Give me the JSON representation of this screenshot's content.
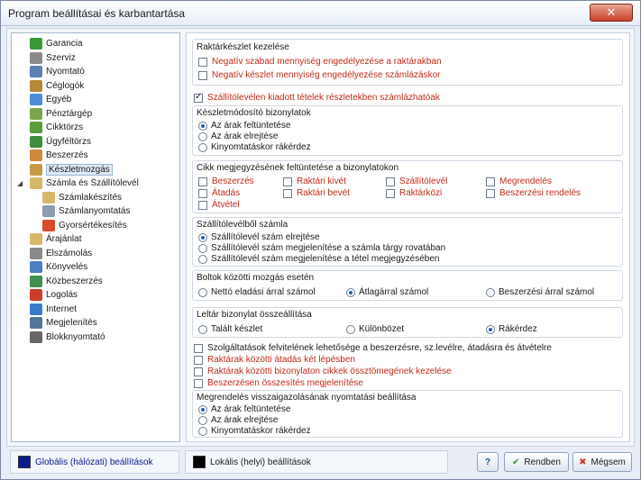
{
  "window": {
    "title": "Program beállításai és karbantartása",
    "close_glyph": "✕"
  },
  "tree": [
    {
      "label": "Garancia",
      "icon": "shield-icon",
      "color": "#3a9a3a",
      "level": 1,
      "selected": false
    },
    {
      "label": "Szerviz",
      "icon": "wrench-icon",
      "color": "#8a8a8a",
      "level": 1,
      "selected": false
    },
    {
      "label": "Nyomtató",
      "icon": "printer-icon",
      "color": "#5b7fb1",
      "level": 1,
      "selected": false
    },
    {
      "label": "Céglogók",
      "icon": "logo-icon",
      "color": "#b5883a",
      "level": 1,
      "selected": false
    },
    {
      "label": "Egyéb",
      "icon": "home-icon",
      "color": "#4d8ed6",
      "level": 1,
      "selected": false
    },
    {
      "label": "Pénztárgép",
      "icon": "cash-register-icon",
      "color": "#7aa64e",
      "level": 1,
      "selected": false
    },
    {
      "label": "Cikktörzs",
      "icon": "product-icon",
      "color": "#5a9e3c",
      "level": 1,
      "selected": false
    },
    {
      "label": "Ügyféltörzs",
      "icon": "customer-icon",
      "color": "#3d8d3d",
      "level": 1,
      "selected": false
    },
    {
      "label": "Beszerzés",
      "icon": "purchase-icon",
      "color": "#cf8a3c",
      "level": 1,
      "selected": false
    },
    {
      "label": "Készletmozgás",
      "icon": "stock-movement-icon",
      "color": "#c69a45",
      "level": 1,
      "selected": true
    },
    {
      "label": "Számla és Szállítólevél",
      "icon": "invoice-icon",
      "color": "#d7b86a",
      "level": 1,
      "selected": false,
      "expanded": true
    },
    {
      "label": "Számlakészítés",
      "icon": "invoice-create-icon",
      "color": "#d7b86a",
      "level": 2,
      "selected": false
    },
    {
      "label": "Számlanyomtatás",
      "icon": "invoice-print-icon",
      "color": "#8d9bb0",
      "level": 2,
      "selected": false
    },
    {
      "label": "Gyorsértékesítés",
      "icon": "quick-sale-icon",
      "color": "#d74c2c",
      "level": 2,
      "selected": false
    },
    {
      "label": "Árajánlat",
      "icon": "quote-icon",
      "color": "#d7b86a",
      "level": 1,
      "selected": false
    },
    {
      "label": "Elszámolás",
      "icon": "settlement-icon",
      "color": "#8a8a8a",
      "level": 1,
      "selected": false
    },
    {
      "label": "Könyvelés",
      "icon": "accounting-icon",
      "color": "#4f7ec2",
      "level": 1,
      "selected": false
    },
    {
      "label": "Közbeszerzés",
      "icon": "public-procurement-icon",
      "color": "#3f8f4f",
      "level": 1,
      "selected": false
    },
    {
      "label": "Logolás",
      "icon": "log-icon",
      "color": "#cc3d2d",
      "level": 1,
      "selected": false
    },
    {
      "label": "Internet",
      "icon": "globe-icon",
      "color": "#3a7bc8",
      "level": 1,
      "selected": false
    },
    {
      "label": "Megjelenítés",
      "icon": "display-icon",
      "color": "#557499",
      "level": 1,
      "selected": false
    },
    {
      "label": "Blokknyomtató",
      "icon": "receipt-printer-icon",
      "color": "#666666",
      "level": 1,
      "selected": false
    }
  ],
  "inventory": {
    "title": "Raktárkészlet kezelése",
    "options": [
      {
        "label": "Negatív szabad mennyiség engedélyezése a raktárakban",
        "checked": false
      },
      {
        "label": "Negatív készlet mennyiség engedélyezése számlázáskor",
        "checked": false
      }
    ]
  },
  "partial_delivery": {
    "label": "Szállítólevélen kiadott tételek részletekben számlázhatóak",
    "checked": true
  },
  "stock_docs": {
    "title": "Készletmódosító bizonylatok",
    "options": [
      {
        "label": "Az árak feltüntetése",
        "checked": true
      },
      {
        "label": "Az árak elrejtése",
        "checked": false
      },
      {
        "label": "Kinyomtatáskor rákérdez",
        "checked": false
      }
    ]
  },
  "notes": {
    "title": "Cikk megjegyzésének feltüntetése a bizonylatokon",
    "items": [
      {
        "label": "Beszerzés",
        "checked": false
      },
      {
        "label": "Raktári kivét",
        "checked": false
      },
      {
        "label": "Szállítólevél",
        "checked": false
      },
      {
        "label": "Megrendelés",
        "checked": false
      },
      {
        "label": "Átadás",
        "checked": false
      },
      {
        "label": "Raktári bevét",
        "checked": false
      },
      {
        "label": "Raktárközi",
        "checked": false
      },
      {
        "label": "Beszerzési rendelés",
        "checked": false
      },
      {
        "label": "Átvétel",
        "checked": false
      }
    ]
  },
  "delivery_invoice": {
    "title": "Szállítólevélből számla",
    "options": [
      {
        "label": "Szállítólevél szám elrejtése",
        "checked": true
      },
      {
        "label": "Szállítólevél szám megjelenítése a számla tárgy rovatában",
        "checked": false
      },
      {
        "label": "Szállítólevél szám megjelenítése a tétel megjegyzésében",
        "checked": false
      }
    ]
  },
  "shop_move": {
    "title": "Boltok közötti mozgás esetén",
    "options": [
      {
        "label": "Nettó eladási árral számol",
        "checked": false
      },
      {
        "label": "Átlagárral számol",
        "checked": true
      },
      {
        "label": "Beszerzési árral számol",
        "checked": false
      }
    ]
  },
  "inventory_doc": {
    "title": "Leltár bizonylat összeállítása",
    "options": [
      {
        "label": "Talált készlet",
        "checked": false
      },
      {
        "label": "Különbözet",
        "checked": false
      },
      {
        "label": "Rákérdez",
        "checked": true
      }
    ]
  },
  "misc": [
    {
      "label": "Szolgáltatások felvitelének lehetősége a beszerzésre, sz.levélre, átadásra és átvételre",
      "checked": false
    },
    {
      "label": "Raktárak közötti átadás két lépésben",
      "checked": false
    },
    {
      "label": "Raktárak közötti bizonylaton cikkek össztömegének kezelése",
      "checked": false
    },
    {
      "label": "Beszerzésen összesítés megjelenítése",
      "checked": false
    }
  ],
  "order_print": {
    "title": "Megrendelés visszaigazolásának nyomtatási beállítása",
    "options": [
      {
        "label": "Az árak feltüntetése",
        "checked": true
      },
      {
        "label": "Az árak elrejtése",
        "checked": false
      },
      {
        "label": "Kinyomtatáskor rákérdez",
        "checked": false
      }
    ]
  },
  "footer": {
    "global_label": "Globális (hálózati) beállítások",
    "global_color": "#0a1a8c",
    "local_label": "Lokális (helyi) beállítások",
    "local_color": "#000000",
    "help_label": "?",
    "ok_label": "Rendben",
    "ok_icon": "checkmark-icon",
    "cancel_label": "Mégsem",
    "cancel_icon": "cross-icon"
  }
}
